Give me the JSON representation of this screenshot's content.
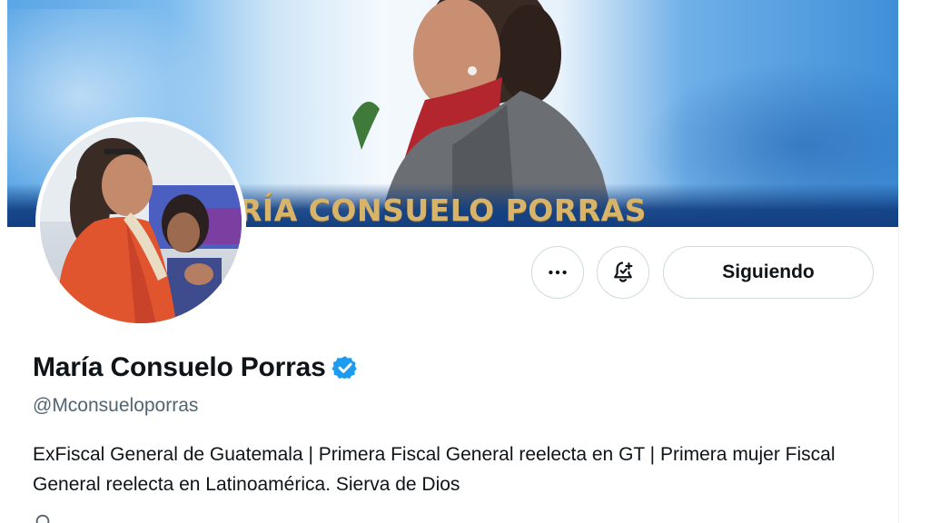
{
  "banner": {
    "title_text": "RÍA CONSUELO PORRAS"
  },
  "profile": {
    "display_name": "María Consuelo Porras",
    "handle": "@Mconsueloporras",
    "bio": "ExFiscal General de Guatemala | Primera Fiscal General reelecta en GT | Primera mujer Fiscal General reelecta en Latinoamérica. Sierva de Dios",
    "verified": true
  },
  "actions": {
    "more_icon": "more-horizontal-icon",
    "notify_icon": "bell-plus-icon",
    "following_label": "Siguiendo"
  },
  "colors": {
    "verified_blue": "#1d9bf0",
    "text_primary": "#0f1419",
    "text_secondary": "#536471",
    "border": "#cfd9de",
    "banner_gold": "#d8b36a"
  }
}
